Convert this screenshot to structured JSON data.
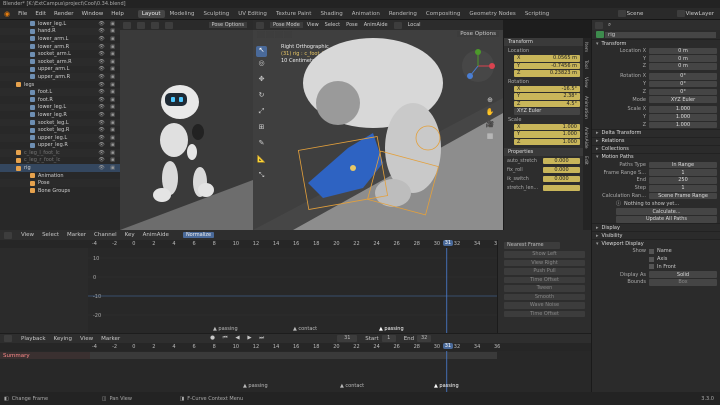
{
  "window_title": "Blender* [K:\\ExtCampus\\project\\Cool\\0.34.blend]",
  "menus": [
    "File",
    "Edit",
    "Render",
    "Window",
    "Help"
  ],
  "workspaces": [
    "Layout",
    "Modeling",
    "Sculpting",
    "UV Editing",
    "Texture Paint",
    "Shading",
    "Animation",
    "Rendering",
    "Compositing",
    "Geometry Nodes",
    "Scripting"
  ],
  "active_workspace": "Layout",
  "scene_label": "Scene",
  "view_layer_label": "ViewLayer",
  "outliner_rows": [
    {
      "name": "lower_leg.L",
      "type": "bone"
    },
    {
      "name": "hand.R",
      "type": "bone"
    },
    {
      "name": "lower_arm.L",
      "type": "bone"
    },
    {
      "name": "lower_arm.R",
      "type": "bone"
    },
    {
      "name": "socket_arm.L",
      "type": "bone"
    },
    {
      "name": "socket_arm.R",
      "type": "bone"
    },
    {
      "name": "upper_arm.L",
      "type": "bone"
    },
    {
      "name": "upper_arm.R",
      "type": "bone"
    },
    {
      "name": "legs",
      "type": "group"
    },
    {
      "name": "foot.L",
      "type": "bone"
    },
    {
      "name": "foot.R",
      "type": "bone"
    },
    {
      "name": "lower_leg.L",
      "type": "bone"
    },
    {
      "name": "lower_leg.R",
      "type": "bone"
    },
    {
      "name": "socket_leg.L",
      "type": "bone"
    },
    {
      "name": "socket_leg.R",
      "type": "bone"
    },
    {
      "name": "upper_leg.L",
      "type": "bone"
    },
    {
      "name": "upper_leg.R",
      "type": "bone"
    },
    {
      "name": "c_leg_l_foot_lc",
      "type": "obj"
    },
    {
      "name": "c_leg_r_foot_lc",
      "type": "obj"
    },
    {
      "name": "rig",
      "type": "obj"
    },
    {
      "name": "Animation",
      "type": "sub"
    },
    {
      "name": "Pose",
      "type": "sub"
    },
    {
      "name": "Bone Groups",
      "type": "sub"
    }
  ],
  "viewport": {
    "mode": "Pose Mode",
    "menu": [
      "View",
      "Select",
      "Pose",
      "AnimAide"
    ],
    "orientation": "Local",
    "pose_options": "Pose Options",
    "overlay_title": "Right Orthographic",
    "overlay_obj": "(31) rig : c_foot_ik.l",
    "overlay_scale": "10 Centimeters"
  },
  "npanel": {
    "tab_label": "Location",
    "header": "Transform",
    "location": [
      {
        "axis": "X",
        "value": "0.0565 m"
      },
      {
        "axis": "Y",
        "value": "-0.7456 m"
      },
      {
        "axis": "Z",
        "value": "0.23823 m"
      }
    ],
    "rotation_label": "Rotation",
    "rotation": [
      {
        "axis": "X",
        "value": "-16.5°"
      },
      {
        "axis": "Y",
        "value": "2.38°"
      },
      {
        "axis": "Z",
        "value": "4.5°"
      }
    ],
    "rot_mode": "XYZ Euler",
    "scale_label": "Scale",
    "scale": [
      {
        "axis": "X",
        "value": "1.000"
      },
      {
        "axis": "Y",
        "value": "1.000"
      },
      {
        "axis": "Z",
        "value": "1.000"
      }
    ],
    "properties_header": "Properties",
    "props": [
      {
        "name": "auto_stretch",
        "value": "0.000"
      },
      {
        "name": "fix_roll",
        "value": "0.000"
      },
      {
        "name": "ik_switch",
        "value": "0.000"
      },
      {
        "name": "stretch_len...",
        "value": ""
      }
    ]
  },
  "side_tabs": [
    "Item",
    "Tool",
    "View",
    "Animation",
    "AnimAide",
    "Edit"
  ],
  "props_editor": {
    "object": "rig",
    "transform_header": "Transform",
    "location": [
      {
        "label": "Location X",
        "value": "0 m"
      },
      {
        "label": "Y",
        "value": "0 m"
      },
      {
        "label": "Z",
        "value": "0 m"
      }
    ],
    "rotation": [
      {
        "label": "Rotation X",
        "value": "0°"
      },
      {
        "label": "Y",
        "value": "0°"
      },
      {
        "label": "Z",
        "value": "0°"
      }
    ],
    "mode_label": "Mode",
    "mode_value": "XYZ Euler",
    "scale": [
      {
        "label": "Scale X",
        "value": "1.000"
      },
      {
        "label": "Y",
        "value": "1.000"
      },
      {
        "label": "Z",
        "value": "1.000"
      }
    ],
    "delta": "Delta Transform",
    "relations": "Relations",
    "collections": "Collections",
    "motion_paths": "Motion Paths",
    "paths_type_label": "Paths Type",
    "paths_type": "In Range",
    "frame_range_start_label": "Frame Range S...",
    "frame_range_start": "1",
    "end_label": "End",
    "end": "250",
    "step_label": "Step",
    "step": "1",
    "calc_label": "Calculation Ran...",
    "calc_value": "Scene Frame Range",
    "nothing_msg": "Nothing to show yet...",
    "calc_button": "Calculate...",
    "update_button": "Update All Paths",
    "display": "Display",
    "visibility": "Visibility",
    "viewport_display": "Viewport Display",
    "show_label": "Show",
    "show_opts": [
      "Name",
      "Axis",
      "In Front"
    ],
    "display_as_label": "Display As",
    "display_as": "Solid",
    "bounds_label": "Bounds",
    "bounds": "Box"
  },
  "graph_editor": {
    "menu": [
      "View",
      "Select",
      "Marker",
      "Channel",
      "Key",
      "AnimAide"
    ],
    "normalize": "Normalize",
    "pivot": "Nearest Frame",
    "frames": [
      -4,
      -2,
      0,
      2,
      4,
      6,
      8,
      10,
      12,
      14,
      16,
      18,
      20,
      22,
      24,
      26,
      28,
      30,
      32,
      34,
      36
    ],
    "current_frame": "31",
    "y_ticks": [
      "10",
      "0",
      "-10",
      "-20"
    ],
    "markers": [
      "passing",
      "contact",
      "passing"
    ],
    "side_buttons": [
      "Show Left",
      "View Right",
      "Push Pull",
      "Time Offset",
      "Tween",
      "Smooth",
      "Wave Noise",
      "Time Offset"
    ]
  },
  "dopesheet": {
    "menu": [
      "Playback",
      "Keying",
      "View",
      "Marker"
    ],
    "start_label": "Start",
    "start": "1",
    "end_label": "End",
    "end": "32",
    "current_frame": "31",
    "summary": "Summary",
    "frames": [
      -4,
      -2,
      0,
      2,
      4,
      6,
      8,
      10,
      12,
      14,
      16,
      18,
      20,
      22,
      24,
      26,
      28,
      30,
      32,
      34,
      36
    ],
    "markers": [
      "passing",
      "contact",
      "passing"
    ]
  },
  "status": {
    "left": "Change Frame",
    "mid": "Pan View",
    "right": "F-Curve Context Menu",
    "version": "3.3.0"
  }
}
